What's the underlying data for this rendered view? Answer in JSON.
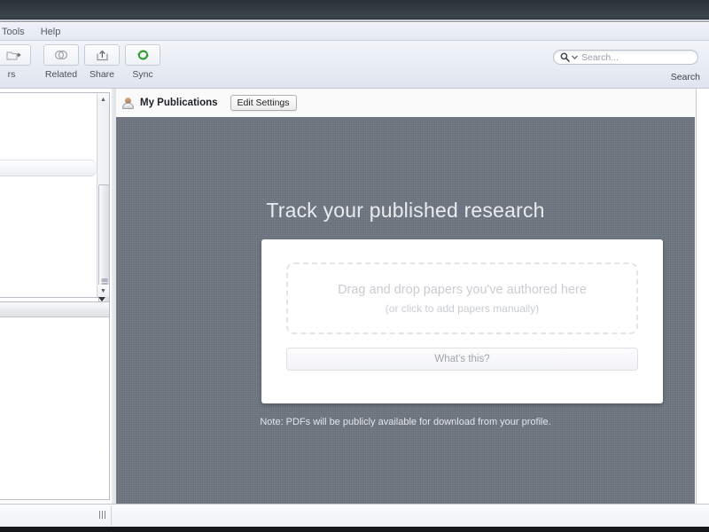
{
  "window": {
    "titlebar_color": "#343c44",
    "accent_green": "#2f9e2f",
    "canvas_color": "#6c747f"
  },
  "menubar": {
    "items": [
      {
        "label": "Tools",
        "clipped": true
      },
      {
        "label": "Help",
        "clipped": false
      }
    ]
  },
  "toolbar": {
    "buttons": [
      {
        "label": "rs",
        "icon": "folders-icon",
        "clipped": true
      },
      {
        "label": "Related",
        "icon": "related-circles-icon",
        "clipped": false
      },
      {
        "label": "Share",
        "icon": "share-arrow-icon",
        "clipped": false
      },
      {
        "label": "Sync",
        "icon": "sync-refresh-icon",
        "clipped": false
      }
    ]
  },
  "search": {
    "placeholder": "Search...",
    "icon": "search-magnifier-icon",
    "dropdown_icon": "chevron-down-icon",
    "label": "Search"
  },
  "sidebar": {
    "top_panel": {
      "scrollbar": {
        "up_arrow": "▲",
        "down_arrow": "▼"
      }
    },
    "bottom_panel": {
      "header_dropdown_icon": "chevron-down-icon"
    }
  },
  "main": {
    "avatar_icon": "user-avatar-icon",
    "title": "My Publications",
    "edit_settings_label": "Edit Settings",
    "headline": "Track your published research",
    "dropzone": {
      "line1": "Drag and drop papers you've authored here",
      "line2": "(or click to add papers manually)"
    },
    "whats_this_label": "What's this?",
    "note": "Note: PDFs will be publicly available for download from your profile."
  }
}
